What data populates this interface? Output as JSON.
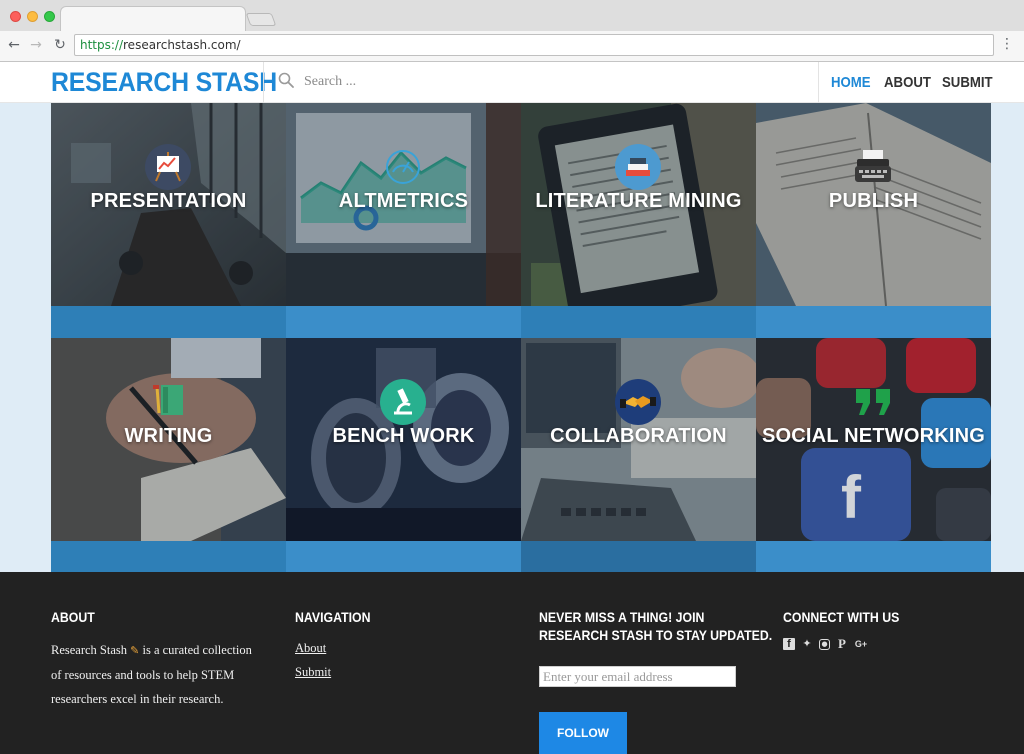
{
  "browser": {
    "url_scheme": "https://",
    "url_rest": "researchstash.com/"
  },
  "header": {
    "logo": "RESEARCH STASH",
    "search_placeholder": "Search ...",
    "nav": {
      "home": "HOME",
      "about": "ABOUT",
      "submit": "SUBMIT"
    }
  },
  "tiles": [
    {
      "label": "PRESENTATION",
      "icon": "easel-chart-icon",
      "bar_color": "#2e7fb7"
    },
    {
      "label": "ALTMETRICS",
      "icon": "gauge-icon",
      "bar_color": "#3b8ec9"
    },
    {
      "label": "LITERATURE MINING",
      "icon": "books-icon",
      "bar_color": "#2e7fb7"
    },
    {
      "label": "PUBLISH",
      "icon": "typewriter-icon",
      "bar_color": "#3b8ec9"
    },
    {
      "label": "WRITING",
      "icon": "notebook-pen-icon",
      "bar_color": "#2e7fb7"
    },
    {
      "label": "BENCH WORK",
      "icon": "microscope-icon",
      "bar_color": "#3b8ec9"
    },
    {
      "label": "COLLABORATION",
      "icon": "handshake-icon",
      "bar_color": "#2a6ea0"
    },
    {
      "label": "SOCIAL NETWORKING",
      "icon": "quote-icon",
      "bar_color": "#3b8ec9"
    }
  ],
  "footer": {
    "about": {
      "heading": "ABOUT",
      "text_before": "Research Stash",
      "text_after": "is a curated collection of resources and tools to help STEM researchers excel in their research."
    },
    "navigation": {
      "heading": "NAVIGATION",
      "links": [
        "About",
        "Submit"
      ]
    },
    "newsletter": {
      "heading_line1": "NEVER MISS A THING! JOIN",
      "heading_line2": "RESEARCH STASH TO STAY UPDATED.",
      "email_placeholder": "Enter your email address",
      "button": "FOLLOW"
    },
    "connect": {
      "heading": "CONNECT WITH US",
      "icons": [
        "facebook-icon",
        "twitter-icon",
        "instagram-icon",
        "pinterest-icon",
        "google-plus-icon"
      ]
    }
  },
  "colors": {
    "brand_blue": "#1e88d6",
    "footer_bg": "#222222",
    "follow_button": "#1e88e5",
    "page_bg": "#dfecf6"
  }
}
